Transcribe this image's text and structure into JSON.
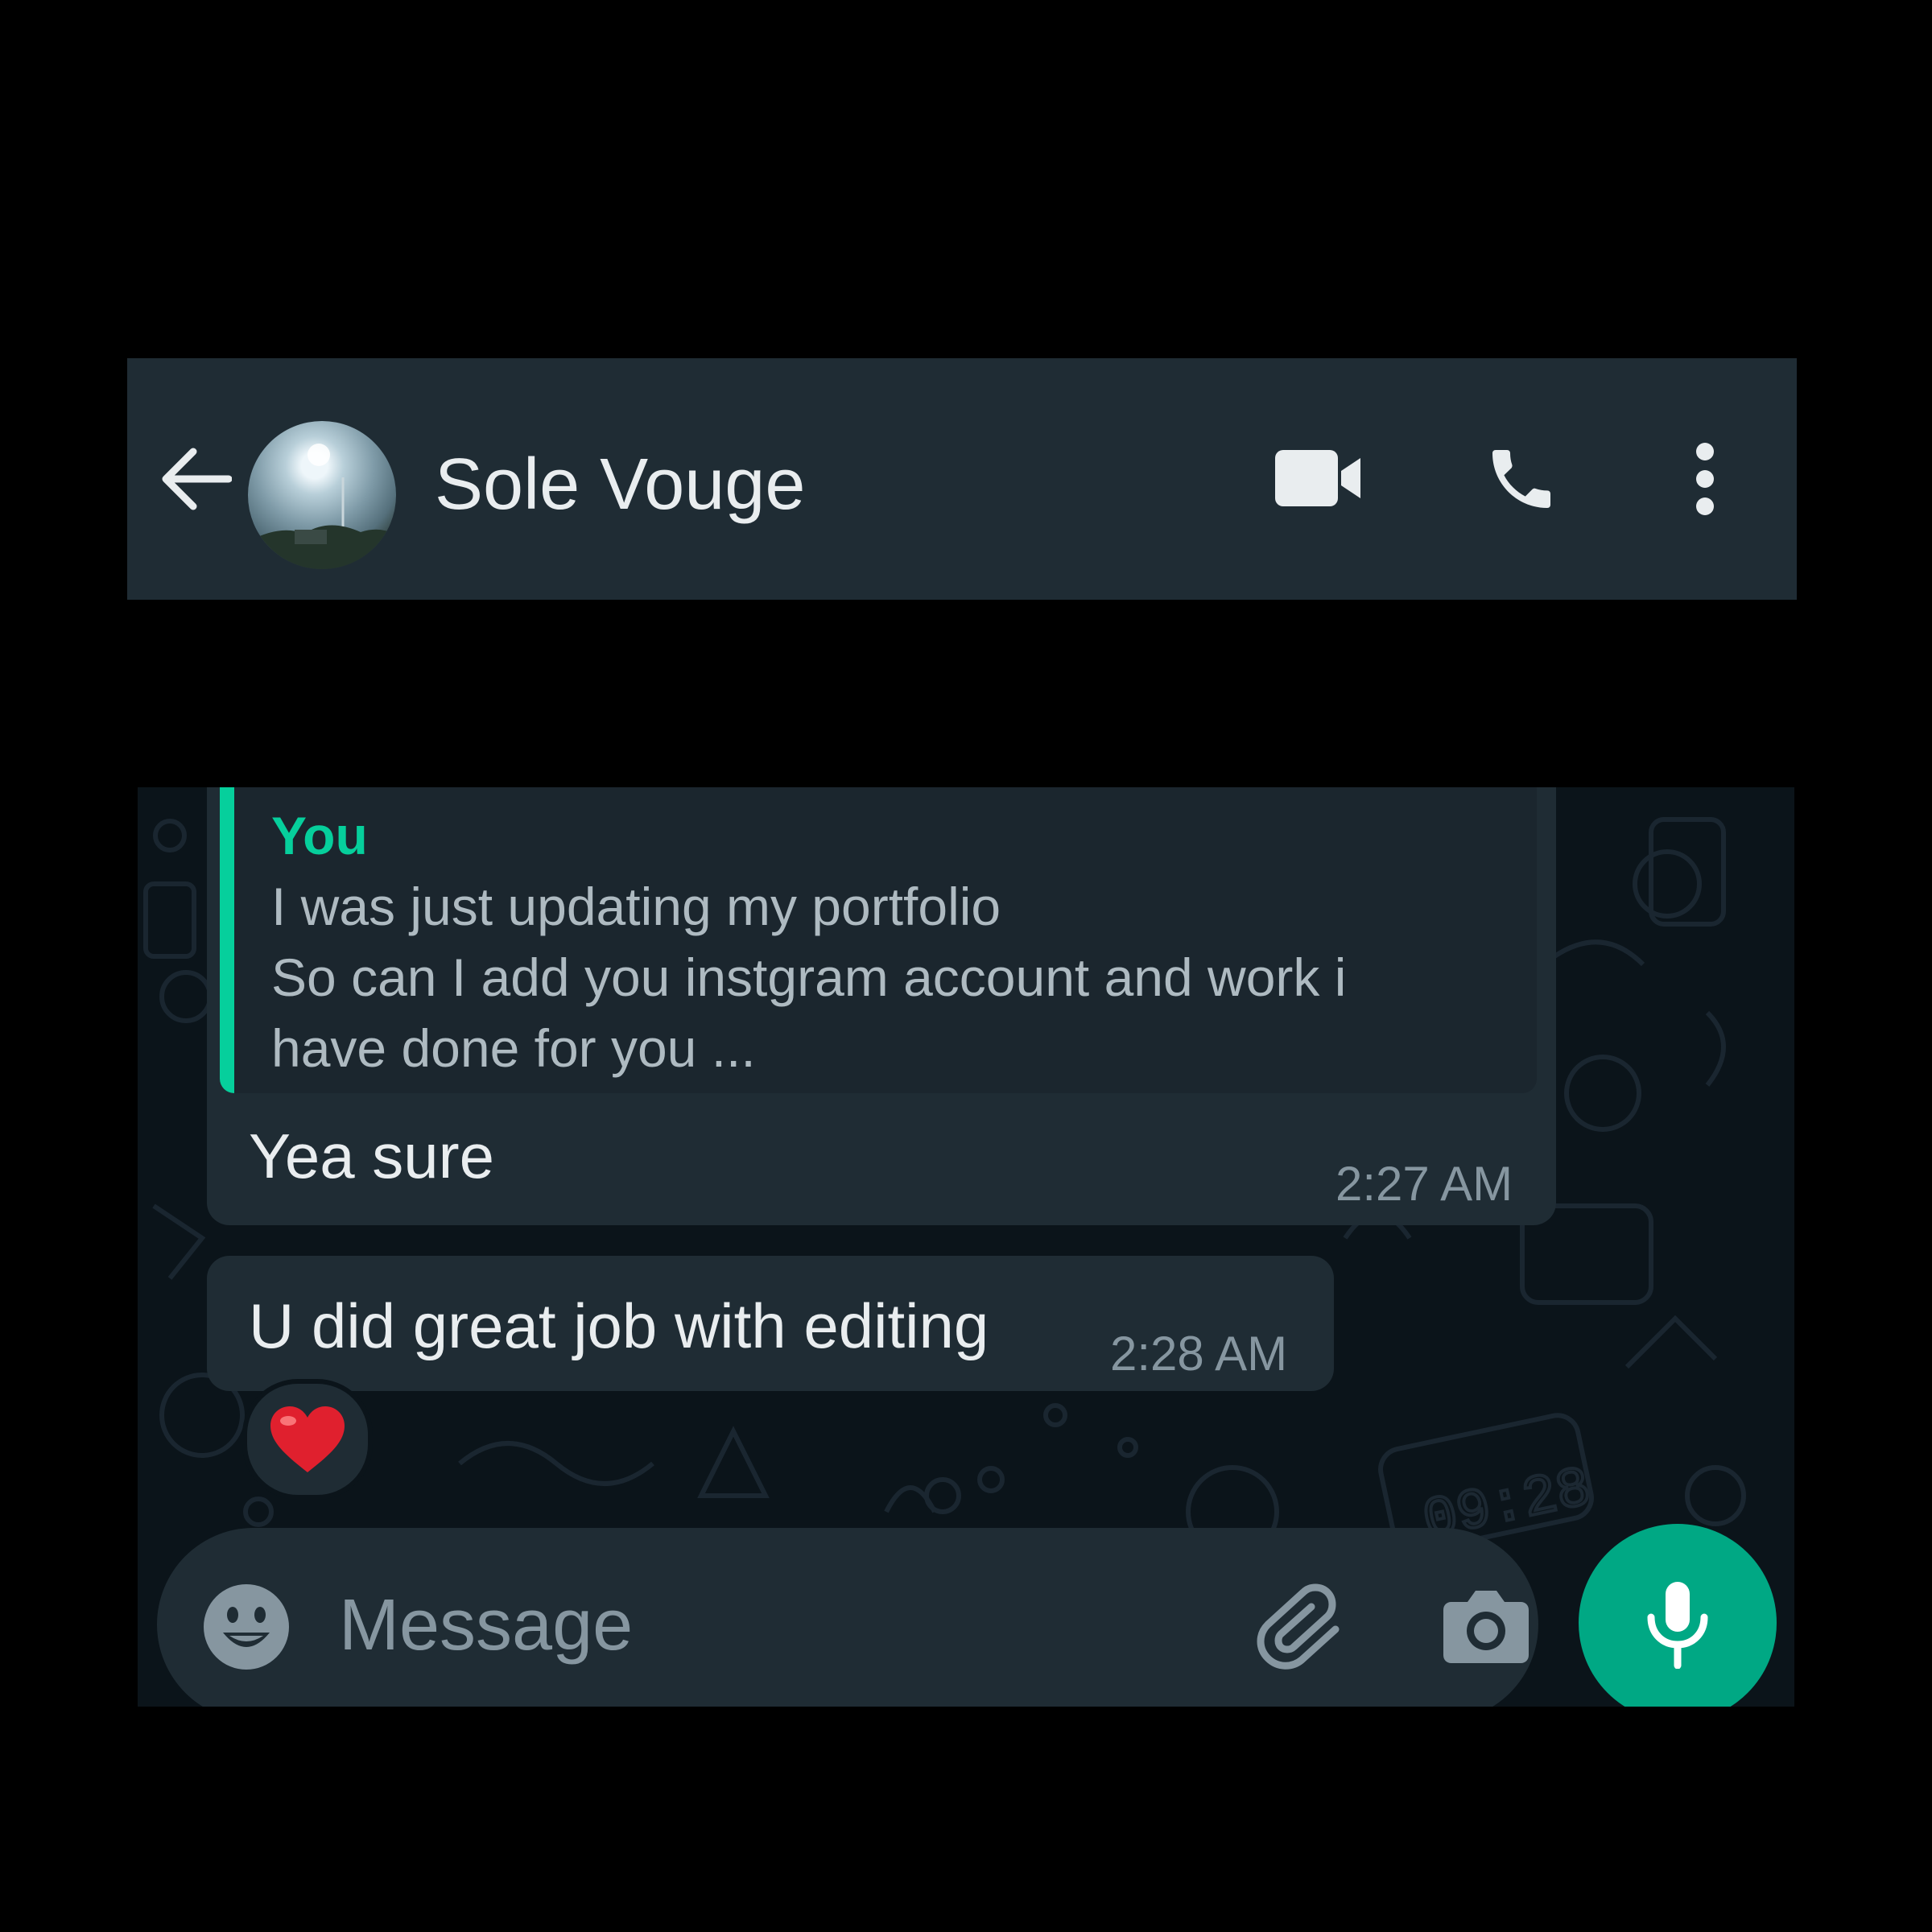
{
  "header": {
    "contact_name": "Sole Vouge",
    "icons": [
      "back-arrow-icon",
      "video-call-icon",
      "voice-call-icon",
      "more-options-icon"
    ]
  },
  "messages": [
    {
      "quote": {
        "author": "You",
        "lines": [
          "I was just updating my portfolio",
          "So can I add you instgram account and work i",
          "have done for you ..."
        ]
      },
      "text": "Yea sure",
      "time": "2:27 AM"
    },
    {
      "text": "U did great job with editing",
      "time": "2:28 AM",
      "reaction": "❤️"
    }
  ],
  "composer": {
    "placeholder": "Message",
    "icons": [
      "emoji-icon",
      "attach-icon",
      "camera-icon",
      "mic-icon"
    ]
  },
  "colors": {
    "header_bg": "#1f2c34",
    "chat_bg": "#0b141a",
    "bubble_bg": "#1f2c34",
    "accent": "#00a884",
    "quote_author": "#06cf9c"
  },
  "background_clock_text": "09:28"
}
